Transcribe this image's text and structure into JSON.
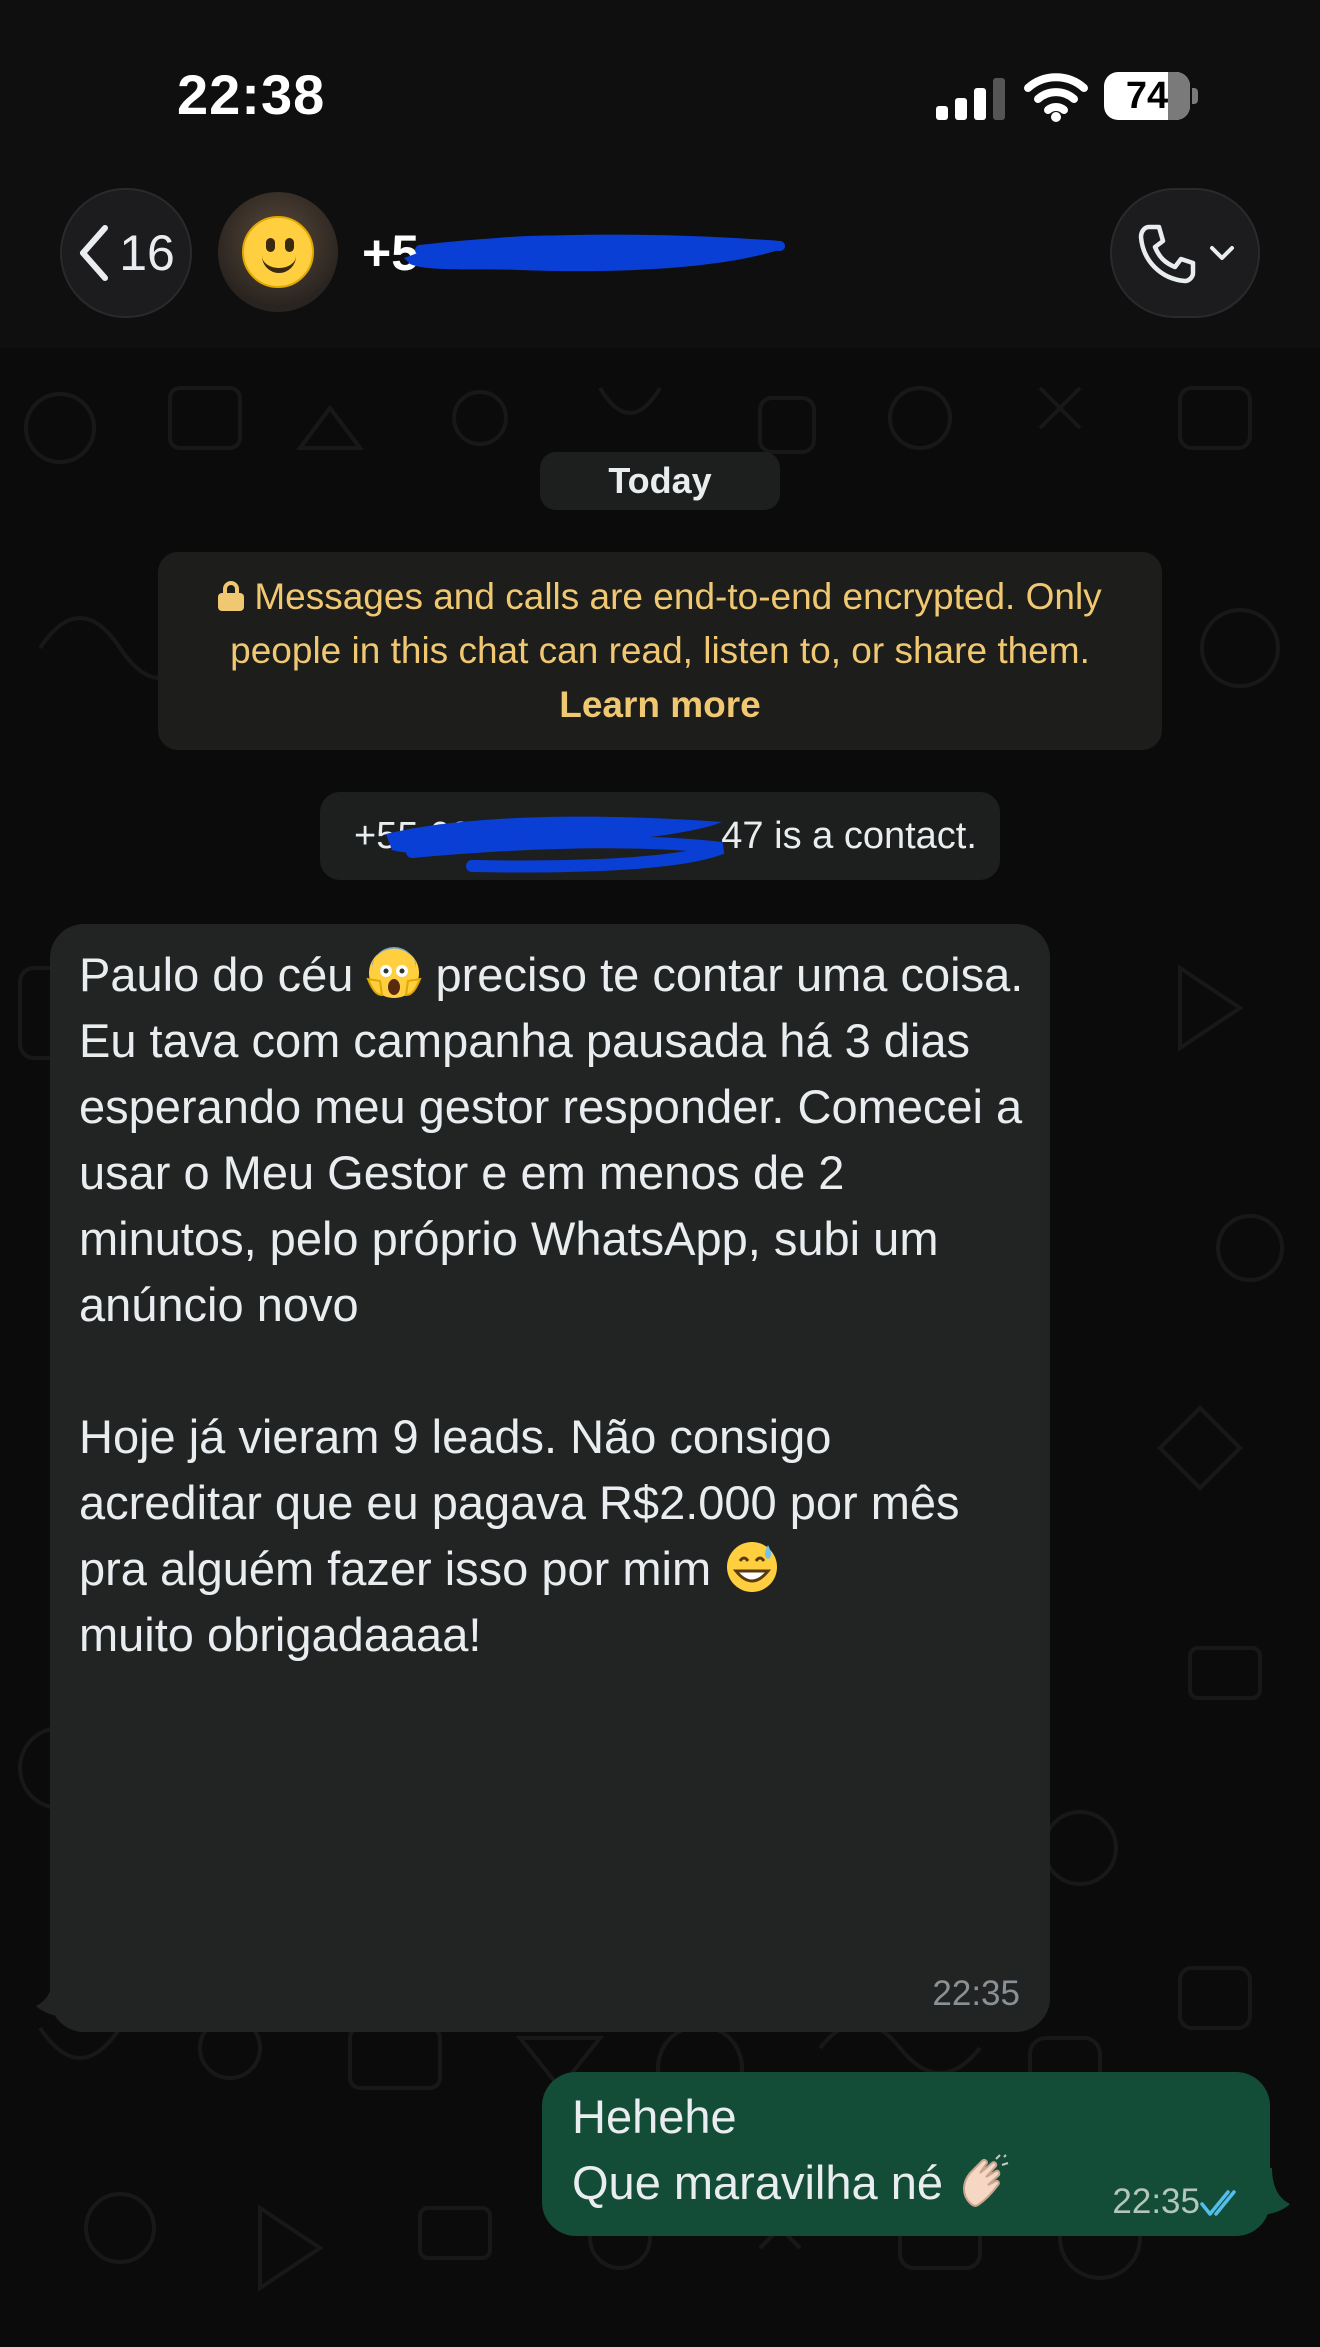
{
  "status_bar": {
    "time": "22:38",
    "battery_percent": "74",
    "battery_level": 0.74,
    "icons": [
      "cellular-signal-icon",
      "wifi-icon",
      "battery-icon"
    ]
  },
  "header": {
    "back_count": "16",
    "contact_name": "+5",
    "contact_name_redacted": true,
    "icons": [
      "chevron-left-icon",
      "avatar-smiley",
      "phone-icon",
      "chevron-down-icon"
    ]
  },
  "chat": {
    "date_label": "Today",
    "encryption": {
      "text": "Messages and calls are end-to-end encrypted. Only people in this chat can read, listen to, or share them.",
      "link": "Learn more"
    },
    "contact_notice": {
      "prefix": "+55 62",
      "suffix": "47 is a contact."
    },
    "messages": [
      {
        "direction": "incoming",
        "part1": "Paulo do céu ",
        "emoji1": "face-screaming-in-fear",
        "part2": " preciso te contar uma coisa. Eu tava com campanha pausada há 3 dias esperando meu gestor responder. Comecei a usar o Meu Gestor e em menos de 2 minutos, pelo próprio WhatsApp, subi um anúncio novo\n\nHoje já vieram 9 leads. Não consigo acreditar que eu pagava R$2.000 por mês pra alguém fazer isso por mim ",
        "emoji2": "grinning-face-with-sweat",
        "part3": "\nmuito obrigadaaaa!",
        "time": "22:35"
      },
      {
        "direction": "outgoing",
        "line1": "Hehehe",
        "line2": "Que maravilha né ",
        "emoji": "clapping-hands",
        "time": "22:35",
        "status": "read"
      }
    ]
  },
  "colors": {
    "incoming_bubble": "#222424",
    "outgoing_bubble": "#134d37",
    "encryption_text": "#f0c872",
    "read_ticks": "#53bdeb",
    "redaction": "#0a3fd6"
  }
}
